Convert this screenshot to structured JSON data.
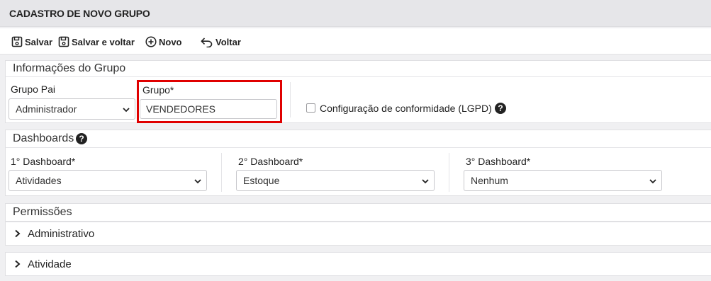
{
  "page": {
    "title": "CADASTRO DE NOVO GRUPO"
  },
  "toolbar": {
    "save_label": "Salvar",
    "save_back_label": "Salvar e voltar",
    "new_label": "Novo",
    "back_label": "Voltar"
  },
  "group_info": {
    "title": "Informações do Grupo",
    "parent_label": "Grupo Pai",
    "parent_value": "Administrador",
    "group_label": "Grupo*",
    "group_value": "VENDEDORES",
    "lgpd_label": "Configuração de conformidade (LGPD)",
    "lgpd_checked": false,
    "help_glyph": "?"
  },
  "dashboards": {
    "title": "Dashboards",
    "help_glyph": "?",
    "d1_label": "1° Dashboard*",
    "d1_value": "Atividades",
    "d2_label": "2° Dashboard*",
    "d2_value": "Estoque",
    "d3_label": "3° Dashboard*",
    "d3_value": "Nenhum"
  },
  "permissions": {
    "title": "Permissões",
    "items": [
      {
        "label": "Administrativo"
      },
      {
        "label": "Atividade"
      }
    ]
  },
  "colors": {
    "highlight": "#e00000",
    "background": "#f0f0f2",
    "title_bar": "#e6e6e9"
  },
  "icons": [
    "floppy-disk-icon",
    "floppy-disk-back-icon",
    "plus-circle-icon",
    "undo-arrow-icon",
    "chevron-down-icon",
    "chevron-right-icon",
    "question-circle-icon"
  ]
}
